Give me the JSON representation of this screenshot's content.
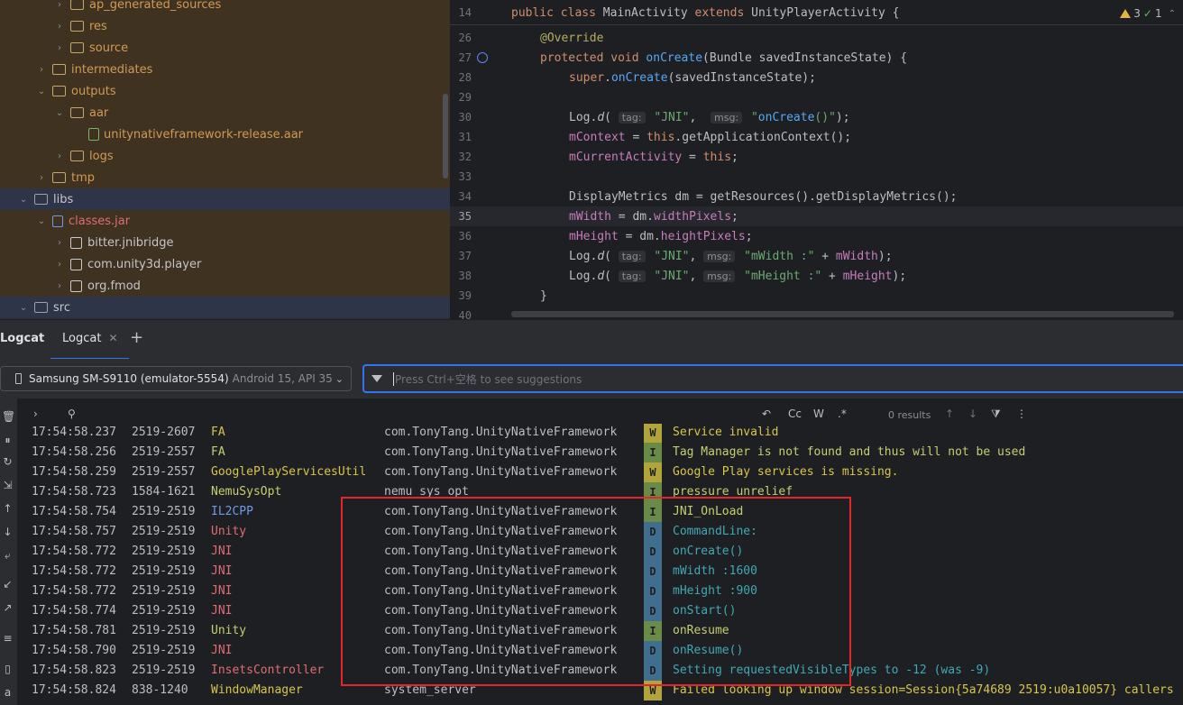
{
  "project_tree": {
    "items": [
      {
        "label": "ap_generated_sources",
        "expanded": false,
        "indent": 4,
        "icon": "folder-icon"
      },
      {
        "label": "res",
        "expanded": false,
        "indent": 4,
        "icon": "folder-icon"
      },
      {
        "label": "source",
        "expanded": false,
        "indent": 4,
        "icon": "folder-icon"
      },
      {
        "label": "intermediates",
        "expanded": false,
        "indent": 3,
        "icon": "folder-icon"
      },
      {
        "label": "outputs",
        "expanded": true,
        "indent": 3,
        "icon": "folder-icon"
      },
      {
        "label": "aar",
        "expanded": true,
        "indent": 4,
        "icon": "folder-icon"
      },
      {
        "label": "unitynativeframework-release.aar",
        "expanded": null,
        "indent": 5,
        "icon": "aar-file-icon"
      },
      {
        "label": "logs",
        "expanded": false,
        "indent": 4,
        "icon": "folder-icon"
      },
      {
        "label": "tmp",
        "expanded": false,
        "indent": 3,
        "icon": "folder-icon"
      },
      {
        "label": "libs",
        "expanded": true,
        "indent": 2,
        "icon": "folder-icon"
      },
      {
        "label": "classes.jar",
        "expanded": true,
        "indent": 3,
        "icon": "jar-icon"
      },
      {
        "label": "bitter.jnibridge",
        "expanded": false,
        "indent": 4,
        "icon": "package-icon"
      },
      {
        "label": "com.unity3d.player",
        "expanded": false,
        "indent": 4,
        "icon": "package-icon"
      },
      {
        "label": "org.fmod",
        "expanded": false,
        "indent": 4,
        "icon": "package-icon"
      },
      {
        "label": "src",
        "expanded": true,
        "indent": 2,
        "icon": "folder-icon"
      }
    ]
  },
  "editor": {
    "sticky_line_number": "14",
    "sticky_line": "public class MainActivity extends UnityPlayerActivity {",
    "problems": {
      "warnings": "3",
      "checks": "1"
    },
    "lines": [
      {
        "n": "26",
        "text": "@Override"
      },
      {
        "n": "27",
        "text": "protected void onCreate(Bundle savedInstanceState) {"
      },
      {
        "n": "28",
        "text": "super.onCreate(savedInstanceState);"
      },
      {
        "n": "29",
        "text": ""
      },
      {
        "n": "30",
        "text": "Log.d( tag: \"JNI\",  msg: \"onCreate()\");"
      },
      {
        "n": "31",
        "text": "mContext = this.getApplicationContext();"
      },
      {
        "n": "32",
        "text": "mCurrentActivity = this;"
      },
      {
        "n": "33",
        "text": ""
      },
      {
        "n": "34",
        "text": "DisplayMetrics dm = getResources().getDisplayMetrics();"
      },
      {
        "n": "35",
        "text": "mWidth = dm.widthPixels;"
      },
      {
        "n": "36",
        "text": "mHeight = dm.heightPixels;"
      },
      {
        "n": "37",
        "text": "Log.d( tag: \"JNI\", msg: \"mWidth :\" + mWidth);"
      },
      {
        "n": "38",
        "text": "Log.d( tag: \"JNI\", msg: \"mHeight :\" + mHeight);"
      },
      {
        "n": "39",
        "text": "}"
      },
      {
        "n": "40",
        "text": ""
      }
    ]
  },
  "logcat": {
    "title": "Logcat",
    "tab_label": "Logcat",
    "device_name": "Samsung SM-S9110 (emulator-5554)",
    "device_sub": "Android 15, API 35",
    "filter_placeholder": "Press Ctrl+空格 to see suggestions",
    "toolbar": {
      "cc": "Cc",
      "w": "W",
      "regex": ".*",
      "results": "0 results"
    },
    "rows": [
      {
        "time": "17:54:58.237",
        "pid": "2519-2607",
        "tag": "FA",
        "pkg": "com.TonyTang.UnityNativeFramework",
        "level": "W",
        "msg": "Service invalid"
      },
      {
        "time": "17:54:58.256",
        "pid": "2519-2557",
        "tag": "FA",
        "pkg": "com.TonyTang.UnityNativeFramework",
        "level": "I",
        "msg": "Tag Manager is not found and thus will not be used"
      },
      {
        "time": "17:54:58.259",
        "pid": "2519-2557",
        "tag": "GooglePlayServicesUtil",
        "pkg": "com.TonyTang.UnityNativeFramework",
        "level": "W",
        "msg": "Google Play services is missing."
      },
      {
        "time": "17:54:58.723",
        "pid": "1584-1621",
        "tag": "NemuSysOpt",
        "pkg": "nemu_sys_opt",
        "level": "I",
        "msg": "pressure unrelief"
      },
      {
        "time": "17:54:58.754",
        "pid": "2519-2519",
        "tag": "IL2CPP",
        "pkg": "com.TonyTang.UnityNativeFramework",
        "level": "I",
        "msg": "JNI_OnLoad"
      },
      {
        "time": "17:54:58.757",
        "pid": "2519-2519",
        "tag": "Unity",
        "pkg": "com.TonyTang.UnityNativeFramework",
        "level": "D",
        "msg": "CommandLine:"
      },
      {
        "time": "17:54:58.772",
        "pid": "2519-2519",
        "tag": "JNI",
        "pkg": "com.TonyTang.UnityNativeFramework",
        "level": "D",
        "msg": "onCreate()"
      },
      {
        "time": "17:54:58.772",
        "pid": "2519-2519",
        "tag": "JNI",
        "pkg": "com.TonyTang.UnityNativeFramework",
        "level": "D",
        "msg": "mWidth :1600"
      },
      {
        "time": "17:54:58.772",
        "pid": "2519-2519",
        "tag": "JNI",
        "pkg": "com.TonyTang.UnityNativeFramework",
        "level": "D",
        "msg": "mHeight :900"
      },
      {
        "time": "17:54:58.774",
        "pid": "2519-2519",
        "tag": "JNI",
        "pkg": "com.TonyTang.UnityNativeFramework",
        "level": "D",
        "msg": "onStart()"
      },
      {
        "time": "17:54:58.781",
        "pid": "2519-2519",
        "tag": "Unity",
        "pkg": "com.TonyTang.UnityNativeFramework",
        "level": "I",
        "msg": "onResume"
      },
      {
        "time": "17:54:58.790",
        "pid": "2519-2519",
        "tag": "JNI",
        "pkg": "com.TonyTang.UnityNativeFramework",
        "level": "D",
        "msg": "onResume()"
      },
      {
        "time": "17:54:58.823",
        "pid": "2519-2519",
        "tag": "InsetsController",
        "pkg": "com.TonyTang.UnityNativeFramework",
        "level": "D",
        "msg": "Setting requestedVisibleTypes to -12 (was -9)"
      },
      {
        "time": "17:54:58.824",
        "pid": " 838-1240",
        "tag": "WindowManager",
        "pkg": "system_server",
        "level": "W",
        "msg": "Failed looking up window session=Session{5a74689 2519:u0a10057} callers"
      }
    ]
  },
  "colors": {
    "accent": "#3574f0",
    "highlight_box": "#e5262b",
    "warn": "#b0a43b",
    "info": "#6a8a48",
    "debug": "#3f6e8e"
  }
}
